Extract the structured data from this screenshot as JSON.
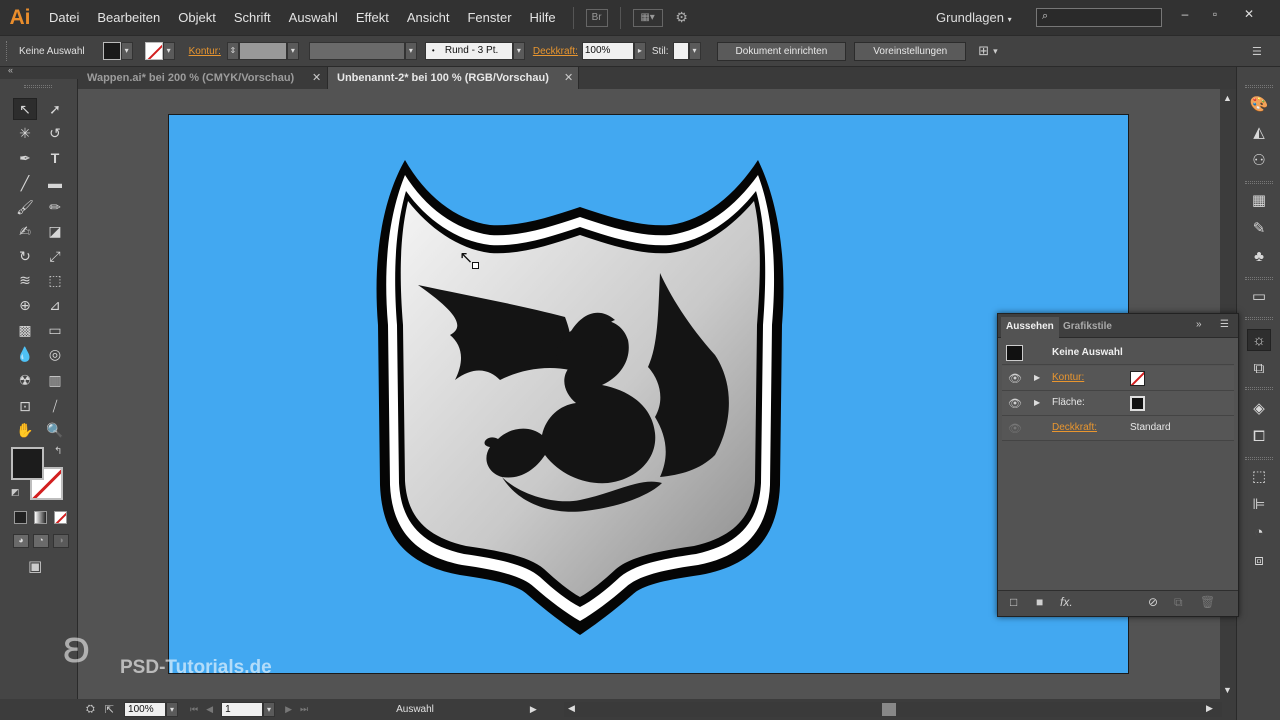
{
  "app": {
    "logo": "Ai",
    "menu": [
      "Datei",
      "Bearbeiten",
      "Objekt",
      "Schrift",
      "Auswahl",
      "Effekt",
      "Ansicht",
      "Fenster",
      "Hilfe"
    ],
    "bridge_icon": "Br",
    "workspace": "Grundlagen",
    "search_placeholder": "",
    "window_buttons": [
      "–",
      "▫",
      "✕"
    ]
  },
  "control_bar": {
    "selection": "Keine Auswahl",
    "stroke_label": "Kontur:",
    "brush": "Rund - 3 Pt.",
    "opacity_label": "Deckkraft:",
    "opacity_value": "100%",
    "style_label": "Stil:",
    "document_setup": "Dokument einrichten",
    "preferences": "Voreinstellungen"
  },
  "tabs": [
    {
      "label": "Wappen.ai* bei 200 % (CMYK/Vorschau)",
      "active": false
    },
    {
      "label": "Unbenannt-2* bei 100 % (RGB/Vorschau)",
      "active": true
    }
  ],
  "status": {
    "zoom": "100%",
    "artboard_number": "1",
    "tool": "Auswahl"
  },
  "appearance_panel": {
    "tabs": [
      "Aussehen",
      "Grafikstile"
    ],
    "header": "Keine Auswahl",
    "rows": [
      {
        "label": "Kontur:",
        "link": true
      },
      {
        "label": "Fläche:",
        "link": false
      },
      {
        "label": "Deckkraft:",
        "link": true,
        "value": "Standard"
      }
    ],
    "footer_fx": "fx."
  },
  "watermark": "PSD-Tutorials.de",
  "colors": {
    "artboard": "#42a8f1",
    "accent": "#e98d2c",
    "link": "#e9962f"
  }
}
